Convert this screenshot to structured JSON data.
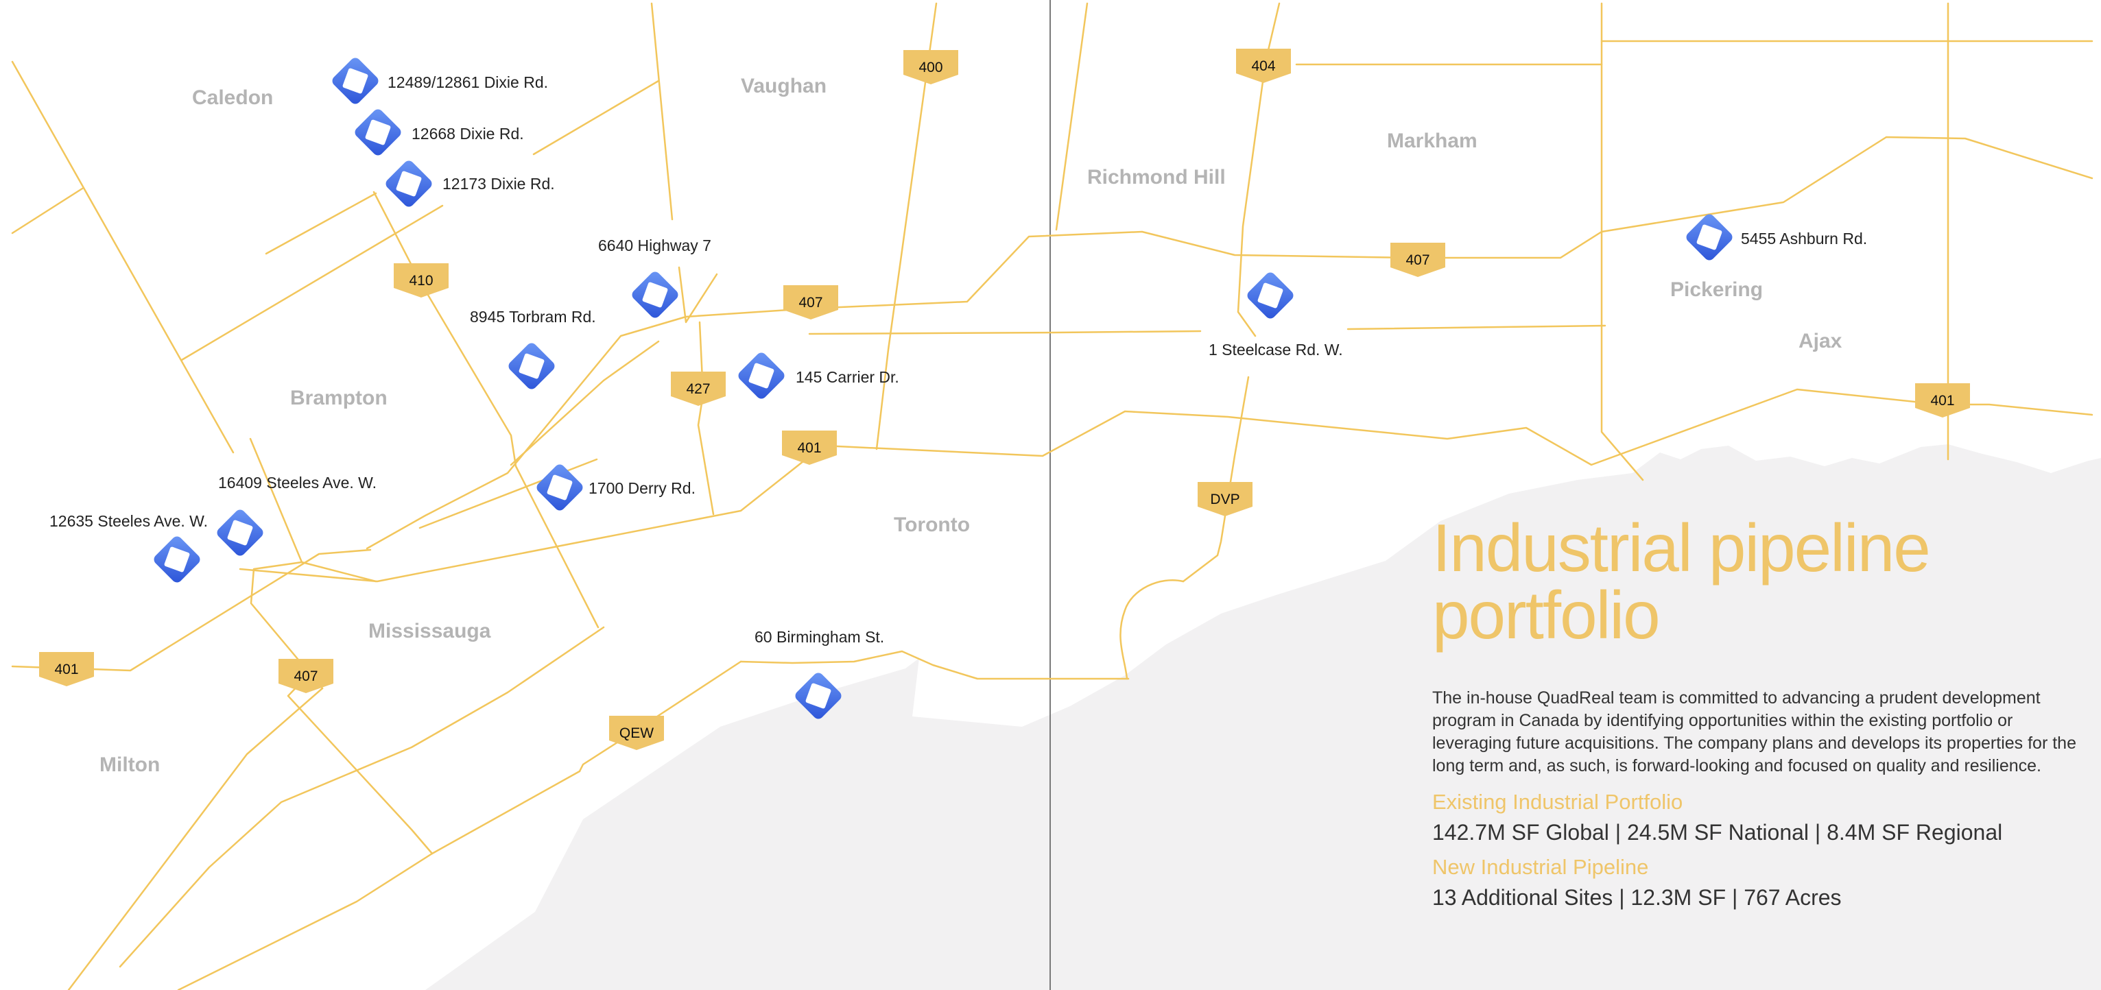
{
  "cities": [
    {
      "id": "caledon",
      "name": "Caledon"
    },
    {
      "id": "vaughan",
      "name": "Vaughan"
    },
    {
      "id": "brampton",
      "name": "Brampton"
    },
    {
      "id": "mississauga",
      "name": "Mississauga"
    },
    {
      "id": "milton",
      "name": "Milton"
    },
    {
      "id": "toronto",
      "name": "Toronto"
    },
    {
      "id": "richmond-hill",
      "name": "Richmond Hill"
    },
    {
      "id": "markham",
      "name": "Markham"
    },
    {
      "id": "pickering",
      "name": "Pickering"
    },
    {
      "id": "ajax",
      "name": "Ajax"
    }
  ],
  "sites": [
    {
      "id": "dixie-12489",
      "label": "12489/12861 Dixie Rd."
    },
    {
      "id": "dixie-12668",
      "label": "12668 Dixie Rd."
    },
    {
      "id": "dixie-12173",
      "label": "12173 Dixie Rd."
    },
    {
      "id": "highway7-6640",
      "label": "6640 Highway 7"
    },
    {
      "id": "torbram-8945",
      "label": "8945 Torbram Rd."
    },
    {
      "id": "carrier-145",
      "label": "145 Carrier Dr."
    },
    {
      "id": "derry-1700",
      "label": "1700 Derry Rd."
    },
    {
      "id": "steeles-16409",
      "label": "16409 Steeles Ave. W."
    },
    {
      "id": "steeles-12635",
      "label": "12635 Steeles Ave. W."
    },
    {
      "id": "birmingham-60",
      "label": "60 Birmingham St."
    },
    {
      "id": "steelcase-1",
      "label": "1 Steelcase Rd. W."
    },
    {
      "id": "ashburn-5455",
      "label": "5455 Ashburn Rd."
    }
  ],
  "highways": [
    {
      "id": "400",
      "label": "400"
    },
    {
      "id": "404",
      "label": "404"
    },
    {
      "id": "410",
      "label": "410"
    },
    {
      "id": "407-a",
      "label": "407"
    },
    {
      "id": "407-b",
      "label": "407"
    },
    {
      "id": "407-c",
      "label": "407"
    },
    {
      "id": "427",
      "label": "427"
    },
    {
      "id": "401-a",
      "label": "401"
    },
    {
      "id": "401-b",
      "label": "401"
    },
    {
      "id": "401-c",
      "label": "401"
    },
    {
      "id": "dvp",
      "label": "DVP"
    },
    {
      "id": "qew",
      "label": "QEW"
    }
  ],
  "panel": {
    "title_line1": "Industrial pipeline",
    "title_line2": "portfolio",
    "description": "The in-house QuadReal team is committed to advancing a prudent development program in Canada by identifying opportunities within the existing portfolio or leveraging future acquisitions. The company plans and develops its properties for the long term and, as such, is forward-looking and focused on quality and resilience.",
    "existing_heading": "Existing Industrial Portfolio",
    "existing_value": "142.7M SF Global | 24.5M SF National | 8.4M SF Regional",
    "pipeline_heading": "New Industrial Pipeline",
    "pipeline_value": "13 Additional Sites | 12.3M SF | 767 Acres"
  },
  "colors": {
    "road": "#f2c65c",
    "shield": "#efc569",
    "water": "#f2f1f2",
    "marker": "#3f6fe6",
    "city_label": "#b4b4b4",
    "title": "#efc569"
  }
}
